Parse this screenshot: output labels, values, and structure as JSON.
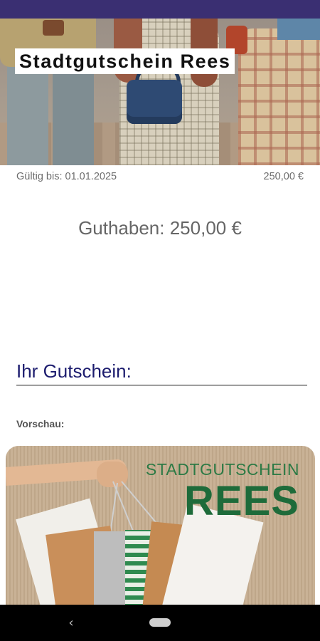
{
  "header": {
    "title": "Stadtgutschein Rees"
  },
  "voucher_info": {
    "valid_until": "Gültig bis: 01.01.2025",
    "amount": "250,00 €",
    "balance": "Guthaben: 250,00 €"
  },
  "section": {
    "heading": "Ihr Gutschein:",
    "preview_label": "Vorschau:"
  },
  "voucher_card": {
    "line1": "STADTGUTSCHEIN",
    "line2": "REES"
  },
  "navigation": {
    "back_icon": "chevron-left-icon",
    "home_icon": "home-pill-icon"
  },
  "colors": {
    "status_bar": "#3a2f72",
    "heading": "#1c1c6e",
    "voucher_green": "#1e6b3a"
  }
}
